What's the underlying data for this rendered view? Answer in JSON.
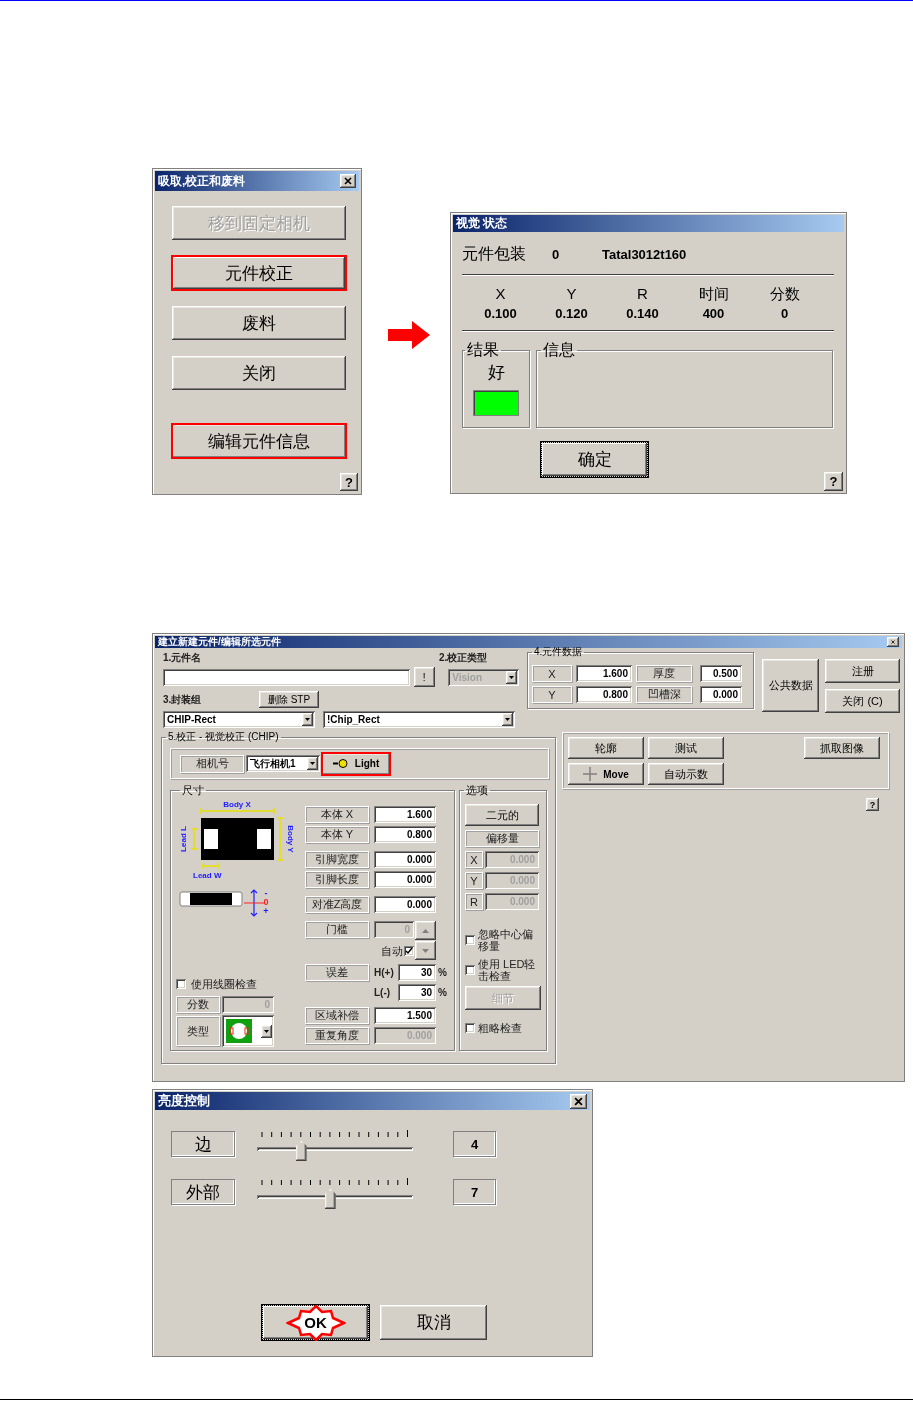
{
  "pick_dialog": {
    "title": "吸取,校正和废料",
    "buttons": [
      {
        "label": "移到固定相机",
        "disabled": true,
        "focused": false,
        "highlighted": false
      },
      {
        "label": "元件校正",
        "disabled": false,
        "focused": true,
        "highlighted": true
      },
      {
        "label": "废料",
        "disabled": false,
        "focused": false,
        "highlighted": false
      },
      {
        "label": "关闭",
        "disabled": false,
        "focused": false,
        "highlighted": false
      },
      {
        "label": "编辑元件信息",
        "disabled": false,
        "focused": false,
        "highlighted": true
      }
    ],
    "help": "?"
  },
  "vision_status": {
    "title": "视觉 状态",
    "package_label": "元件包装",
    "package_count": "0",
    "package_name": "Tatal3012t160",
    "columns": [
      {
        "header": "X",
        "value": "0.100"
      },
      {
        "header": "Y",
        "value": "0.120"
      },
      {
        "header": "R",
        "value": "0.140"
      },
      {
        "header": "时间",
        "value": "400"
      },
      {
        "header": "分数",
        "value": "0"
      }
    ],
    "result": {
      "legend": "结果",
      "text": "好",
      "color": "#00ff00"
    },
    "info": {
      "legend": "信息"
    },
    "ok_button": "确定",
    "help": "?"
  },
  "part_editor": {
    "title": "建立新建元件/编辑所选元件",
    "name_label": "1.元件名",
    "bang_button": "!",
    "calib_type_label": "2.校正类型",
    "calib_type": "Vision",
    "package_group_label": "3.封装组",
    "delete_button": "删除 STP",
    "package_group": "CHIP-Rect",
    "package": "!Chip_Rect",
    "part_data": {
      "legend": "4.元件数据",
      "cells": [
        {
          "label": "X",
          "value": "1.600"
        },
        {
          "label": "厚度",
          "value": "0.500"
        },
        {
          "label": "Y",
          "value": "0.800"
        },
        {
          "label": "凹槽深",
          "value": "0.000"
        }
      ]
    },
    "common_button": "公共数据",
    "register_button": "注册",
    "close_button": "关闭 (C)",
    "calibration": {
      "legend": "5.校正 - 视觉校正 (CHIP)",
      "camera_label": "相机号",
      "camera": "飞行相机1",
      "light_button": {
        "label": "Light",
        "highlighted": true
      }
    },
    "size": {
      "legend": "尺寸",
      "body_x": "Body X",
      "body_y": "Body Y",
      "lead_l": "Lead L",
      "lead_w": "Lead W",
      "z_marks": [
        "-",
        "0",
        "+"
      ],
      "rows": [
        {
          "label": "本体 X",
          "value": "1.600",
          "disabled": false
        },
        {
          "label": "本体 Y",
          "value": "0.800",
          "disabled": false
        },
        {
          "label": "引脚宽度",
          "value": "0.000",
          "disabled": false
        },
        {
          "label": "引脚长度",
          "value": "0.000",
          "disabled": false
        },
        {
          "label": "对准Z高度",
          "value": "0.000",
          "disabled": false
        }
      ],
      "threshold": {
        "label": "门槛",
        "value": "0",
        "disabled": true
      },
      "auto": {
        "label": "自动",
        "checked": true
      },
      "tolerance": {
        "label": "误差",
        "high_label": "H(+)",
        "high": "30",
        "high_unit": "%",
        "low_label": "L(-)",
        "low": "30",
        "low_unit": "%"
      },
      "area_comp": {
        "label": "区域补偿",
        "value": "1.500",
        "disabled": false
      },
      "repeat_angle": {
        "label": "重复角度",
        "value": "0.000",
        "disabled": true
      },
      "coil_check": {
        "label": "使用线圈检查",
        "checked": false
      },
      "score": {
        "label": "分数",
        "value": "0"
      },
      "type_label": "类型"
    },
    "options": {
      "legend": "选项",
      "binary_button": "二元的",
      "offset_label": "偏移量",
      "offsets": [
        {
          "axis": "X",
          "value": "0.000"
        },
        {
          "axis": "Y",
          "value": "0.000"
        },
        {
          "axis": "R",
          "value": "0.000"
        }
      ],
      "checks": [
        {
          "label": "忽略中心偏移量",
          "checked": false
        },
        {
          "label": "使用 LED轻击检查",
          "checked": false
        }
      ],
      "detail_button": {
        "label": "细节",
        "disabled": true
      },
      "rough_check": {
        "label": "粗略检查",
        "checked": false
      }
    },
    "actions": [
      {
        "label": "轮廓",
        "kind": "plain"
      },
      {
        "label": "测试",
        "kind": "plain"
      },
      {
        "label": "抓取图像",
        "kind": "plain"
      },
      {
        "label": "Move",
        "kind": "move"
      },
      {
        "label": "自动示数",
        "kind": "plain"
      }
    ],
    "help": "?"
  },
  "brightness": {
    "title": "亮度控制",
    "sliders": [
      {
        "label": "边",
        "level": 0.27,
        "value": "4"
      },
      {
        "label": "外部",
        "level": 0.47,
        "value": "7"
      }
    ],
    "ok_button": {
      "label": "OK",
      "highlighted": true
    },
    "cancel_button": "取消"
  }
}
